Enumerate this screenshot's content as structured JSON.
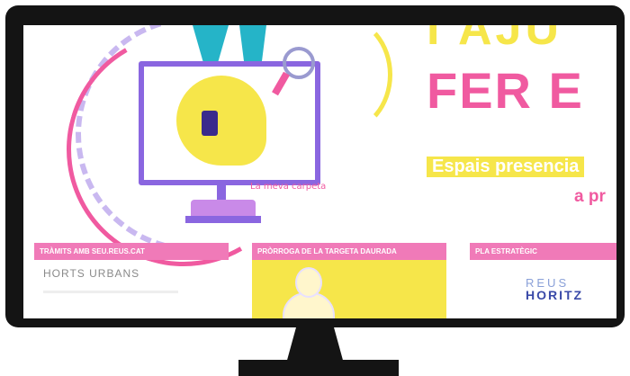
{
  "hero": {
    "headline_line1": "I AJU",
    "headline_line2": "FER E",
    "ribbon_text": "Espais presencia",
    "ribbon_text2": "a pr",
    "illustration_labels": [
      "",
      "",
      "La meva carpeta"
    ]
  },
  "cards": [
    {
      "header": "TRÀMITS AMB SEU.REUS.CAT",
      "body": "HORTS URBANS"
    },
    {
      "header": "PRÒRROGA DE LA TARGETA DAURADA",
      "body": ""
    },
    {
      "header": "PLA ESTRATÈGIC",
      "logo_top": "REUS",
      "logo_bottom": "HORITZ"
    }
  ],
  "colors": {
    "monitor": "#141414",
    "pink": "#f05aa0",
    "yellow": "#f6e64a",
    "purple": "#8a66e0",
    "card_header": "#f07ab8"
  }
}
